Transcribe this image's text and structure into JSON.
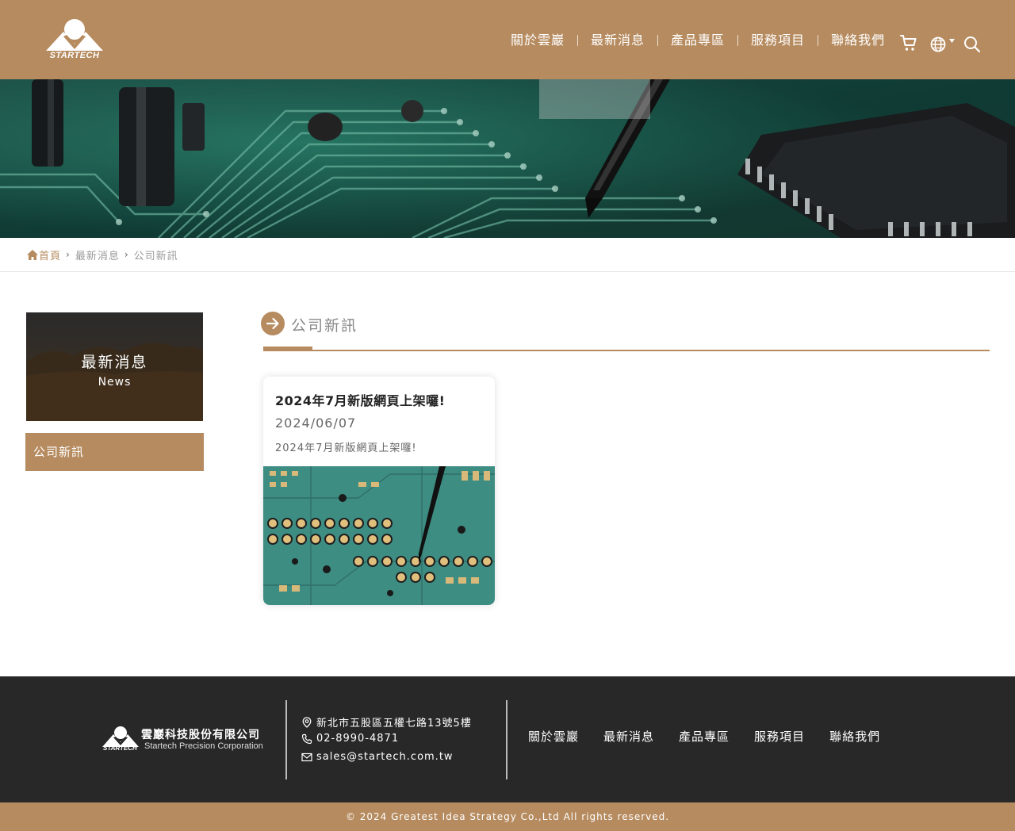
{
  "header": {
    "logo_text": "STARTECH",
    "nav": [
      "關於雲巖",
      "最新消息",
      "產品專區",
      "服務項目",
      "聯絡我們"
    ]
  },
  "breadcrumb": {
    "home": "首頁",
    "level1": "最新消息",
    "level2": "公司新訊"
  },
  "sidebar": {
    "title": "最新消息",
    "subtitle": "News",
    "items": [
      "公司新訊"
    ]
  },
  "section": {
    "title": "公司新訊"
  },
  "posts": [
    {
      "title": "2024年7月新版網頁上架囉!",
      "date": "2024/06/07",
      "summary": "2024年7月新版網頁上架囉!"
    }
  ],
  "footer": {
    "logo_text": "STARTECH",
    "company_zh": "雲巖科技股份有限公司",
    "company_en": "Startech Precision Corporation",
    "address": "新北市五股區五權七路13號5樓",
    "phone": "02-8990-4871",
    "email": "sales@startech.com.tw",
    "nav": [
      "關於雲巖",
      "最新消息",
      "產品專區",
      "服務項目",
      "聯絡我們"
    ],
    "copyright": "© 2024 Greatest Idea Strategy Co.,Ltd All rights reserved."
  },
  "colors": {
    "brand": "#b68b5f",
    "footer_bg": "#282828"
  },
  "icons": [
    "cart-icon",
    "globe-icon",
    "search-icon",
    "home-icon",
    "arrow-right-icon",
    "location-icon",
    "phone-icon",
    "mail-icon"
  ]
}
